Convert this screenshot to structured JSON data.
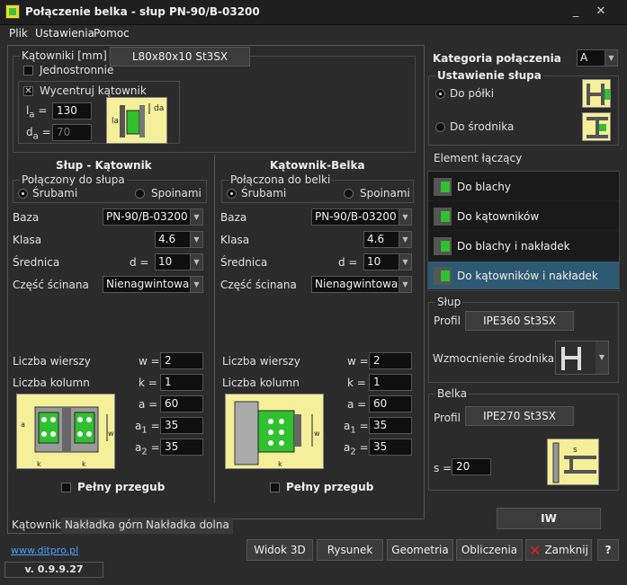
{
  "window": {
    "title": "Połączenie belka - słup  PN-90/B-03200"
  },
  "menu": [
    "Plik",
    "Ustawienia",
    "Pomoc"
  ],
  "katowniki": {
    "group_label": "Kątowniki [mm]",
    "profile_button": "L80x80x10 St3SX",
    "jednostronnie_label": "Jednostronnie",
    "jednostronnie_checked": false,
    "wycentruj_label": "Wycentruj kątownik",
    "wycentruj_checked": true,
    "la_sym": "l",
    "la_sub": "a",
    "la_eq": "=",
    "la_value": "130",
    "da_sym": "d",
    "da_sub": "a",
    "da_eq": "=",
    "da_value": "70"
  },
  "slup_katownik": {
    "title": "Słup - Kątownik",
    "polaczony_label": "Połączony do słupa",
    "srubami": "Śrubami",
    "spoinami": "Spoinami",
    "selected": "Śrubami",
    "baza_label": "Baza",
    "baza_value": "PN-90/B-03200",
    "klasa_label": "Klasa",
    "klasa_value": "4.6",
    "srednica_label": "Średnica",
    "d_label": "d =",
    "d_value": "10",
    "czesc_label": "Część ścinana",
    "czesc_value": "Nienagwintowana",
    "wiersze_label": "Liczba wierszy",
    "w_label": "w =",
    "w_value": "2",
    "kolumn_label": "Liczba kolumn",
    "k_label": "k =",
    "k_value": "1",
    "a_label": "a =",
    "a_value": "60",
    "a1_sym": "a",
    "a1_sub": "1",
    "a1_eq": "=",
    "a1_value": "35",
    "a2_sym": "a",
    "a2_sub": "2",
    "a2_eq": "=",
    "a2_value": "35",
    "przegub_label": "Pełny przegub",
    "przegub_checked": false
  },
  "katownik_belka": {
    "title": "Kątownik-Belka",
    "polaczona_label": "Połączona do belki",
    "srubami": "Śrubami",
    "spoinami": "Spoinami",
    "selected": "Śrubami",
    "baza_label": "Baza",
    "baza_value": "PN-90/B-03200",
    "klasa_label": "Klasa",
    "klasa_value": "4.6",
    "srednica_label": "Średnica",
    "d_label": "d =",
    "d_value": "10",
    "czesc_label": "Część ścinana",
    "czesc_value": "Nienagwintowana",
    "wiersze_label": "Liczba wierszy",
    "w_label": "w =",
    "w_value": "2",
    "kolumn_label": "Liczba kolumn",
    "k_label": "k =",
    "k_value": "1",
    "a_label": "a =",
    "a_value": "60",
    "a1_sym": "a",
    "a1_sub": "1",
    "a1_eq": "=",
    "a1_value": "35",
    "a2_sym": "a",
    "a2_sub": "2",
    "a2_eq": "=",
    "a2_value": "35",
    "przegub_label": "Pełny przegub",
    "przegub_checked": false
  },
  "tabs": [
    "Kątowniki",
    "Nakładka górna",
    "Nakładka dolna"
  ],
  "active_tab": "Kątowniki",
  "right": {
    "kategoria_label": "Kategoria połączenia",
    "kategoria_value": "A",
    "ustawienie_label": "Ustawienie słupa",
    "do_polki": "Do półki",
    "do_srodnika": "Do środnika",
    "ustawienie_selected": "Do półki",
    "element_label": "Element łączący",
    "element_items": [
      "Do blachy",
      "Do kątowników",
      "Do blachy i nakładek",
      "Do kątowników i nakładek"
    ],
    "element_selected": "Do kątowników i nakładek",
    "slup_label": "Słup",
    "profil_label": "Profil",
    "slup_profil": "IPE360 St3SX",
    "wzmocnienie_label": "Wzmocnienie środnika",
    "belka_label": "Belka",
    "belka_profil": "IPE270 St3SX",
    "s_label": "s =",
    "s_value": "20",
    "iw_button": "IW"
  },
  "bottom": {
    "link": "www.ditpro.pl",
    "version": "v. 0.9.9.27",
    "widok3d": "Widok 3D",
    "rysunek": "Rysunek",
    "geometria": "Geometria",
    "obliczenia": "Obliczenia",
    "zamknij": "Zamknij",
    "help": "?"
  },
  "colors": {
    "background": "#2b2b2b",
    "selection": "#2d5a72",
    "diagram": "#f5ef9a",
    "steel_green": "#30c030",
    "accent_link": "#4aa0ff"
  }
}
